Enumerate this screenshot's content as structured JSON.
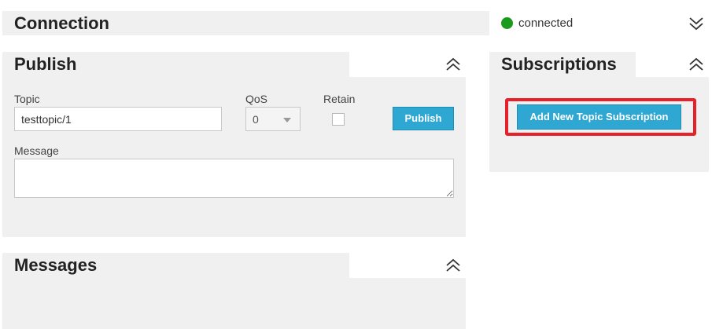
{
  "connection": {
    "title": "Connection",
    "status_text": "connected",
    "status_color": "#1a9a1a"
  },
  "publish": {
    "title": "Publish",
    "topic_label": "Topic",
    "topic_value": "testtopic/1",
    "qos_label": "QoS",
    "qos_value": "0",
    "retain_label": "Retain",
    "retain_checked": false,
    "publish_button": "Publish",
    "message_label": "Message",
    "message_value": ""
  },
  "subscriptions": {
    "title": "Subscriptions",
    "add_button": "Add New Topic Subscription"
  },
  "messages": {
    "title": "Messages"
  },
  "icons": {
    "collapse": "chevron-double-up-icon",
    "expand": "chevron-double-down-icon"
  },
  "colors": {
    "accent": "#2ea7d3",
    "panel_bg": "#f0f0f0",
    "highlight": "#e8202a"
  }
}
